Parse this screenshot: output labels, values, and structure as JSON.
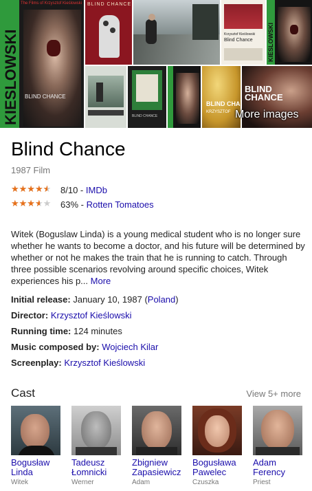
{
  "images": {
    "more_images_label": "More images",
    "captions": {
      "poster1_vertical": "KIESLOWSKI",
      "poster1_series": "The Films of Krzysztof Kieślowski",
      "poster1_title": "BLIND CHANCE",
      "poster2_title": "BLIND CHANCE",
      "poster4_director": "Krzysztof Kieślowski",
      "poster4_title": "Blind Chance",
      "poster5_vertical": "KIESLOWSKI",
      "thumb_b2_title": "BLIND CHANCE",
      "thumb_b4_title": "BLIND CHANCE",
      "thumb_b4_director": "KRZYSZTOF",
      "thumb_b5_title": "BLIND CHANCE"
    }
  },
  "header": {
    "title": "Blind Chance",
    "subtitle": "1987 Film"
  },
  "ratings": [
    {
      "score": "8/10",
      "sep": " - ",
      "source": "IMDb",
      "fraction": 0.8
    },
    {
      "score": "63%",
      "sep": " - ",
      "source": "Rotten Tomatoes",
      "fraction": 0.63
    }
  ],
  "description": {
    "text": "Witek (Boguslaw Linda) is a young medical student who is no longer sure whether he wants to become a doctor, and his future will be determined by whether or not he makes the train that he is running to catch. Through three possible scenarios revolving around specific choices, Witek experiences his p...",
    "more_label": "More"
  },
  "facts": {
    "release_label": "Initial release:",
    "release_value": "January 10, 1987",
    "release_country": "Poland",
    "director_label": "Director:",
    "director_value": "Krzysztof Kieślowski",
    "runtime_label": "Running time:",
    "runtime_value": "124 minutes",
    "music_label": "Music composed by:",
    "music_value": "Wojciech Kilar",
    "screenplay_label": "Screenplay:",
    "screenplay_value": "Krzysztof Kieślowski"
  },
  "cast": {
    "title": "Cast",
    "view_more": "View 5+ more",
    "members": [
      {
        "name": "Bogusław Linda",
        "role": "Witek"
      },
      {
        "name": "Tadeusz Łomnicki",
        "role": "Werner"
      },
      {
        "name": "Zbigniew Zapasiewicz",
        "role": "Adam"
      },
      {
        "name": "Bogusława Pawelec",
        "role": "Czuszka"
      },
      {
        "name": "Adam Ferency",
        "role": "Priest"
      }
    ]
  },
  "colors": {
    "link": "#1a0dab",
    "star": "#e7711b",
    "poster_green": "#2f9a3c"
  }
}
